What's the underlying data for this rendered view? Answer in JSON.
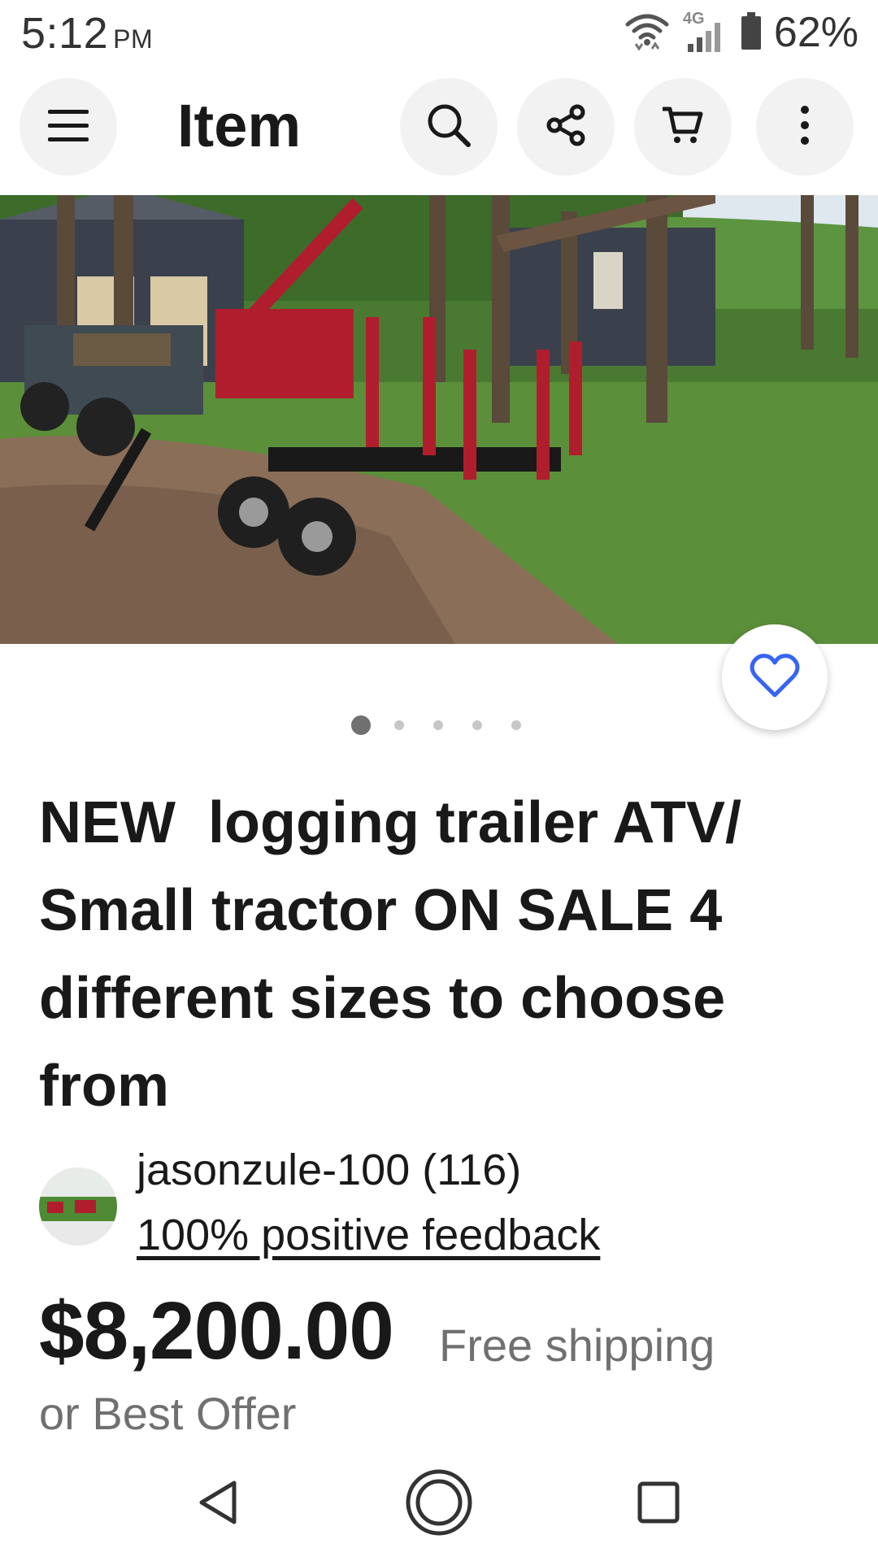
{
  "status_bar": {
    "time": "5:12",
    "ampm": "PM",
    "network": "4G",
    "battery": "62%"
  },
  "app_bar": {
    "title": "Item",
    "icons": [
      "menu-icon",
      "search-icon",
      "share-icon",
      "cart-icon",
      "more-vert-icon"
    ]
  },
  "gallery": {
    "image_count": 5,
    "current_index": 0
  },
  "item": {
    "title": "NEW  logging trailer ATV/ Small tractor ON SALE 4 different sizes to choose from",
    "watch_icon": "heart-outline-icon"
  },
  "seller": {
    "name": "jasonzule-100 (116)",
    "feedback": "100% positive feedback"
  },
  "pricing": {
    "price": "$8,200.00",
    "shipping": "Free shipping",
    "offer": "or Best Offer"
  },
  "nav": {
    "icons": [
      "back-icon",
      "home-icon",
      "recents-icon"
    ]
  },
  "colors": {
    "accent": "#3665f3",
    "text": "#191919",
    "secondary_text": "#707070",
    "button_bg": "#f2f2f2"
  }
}
